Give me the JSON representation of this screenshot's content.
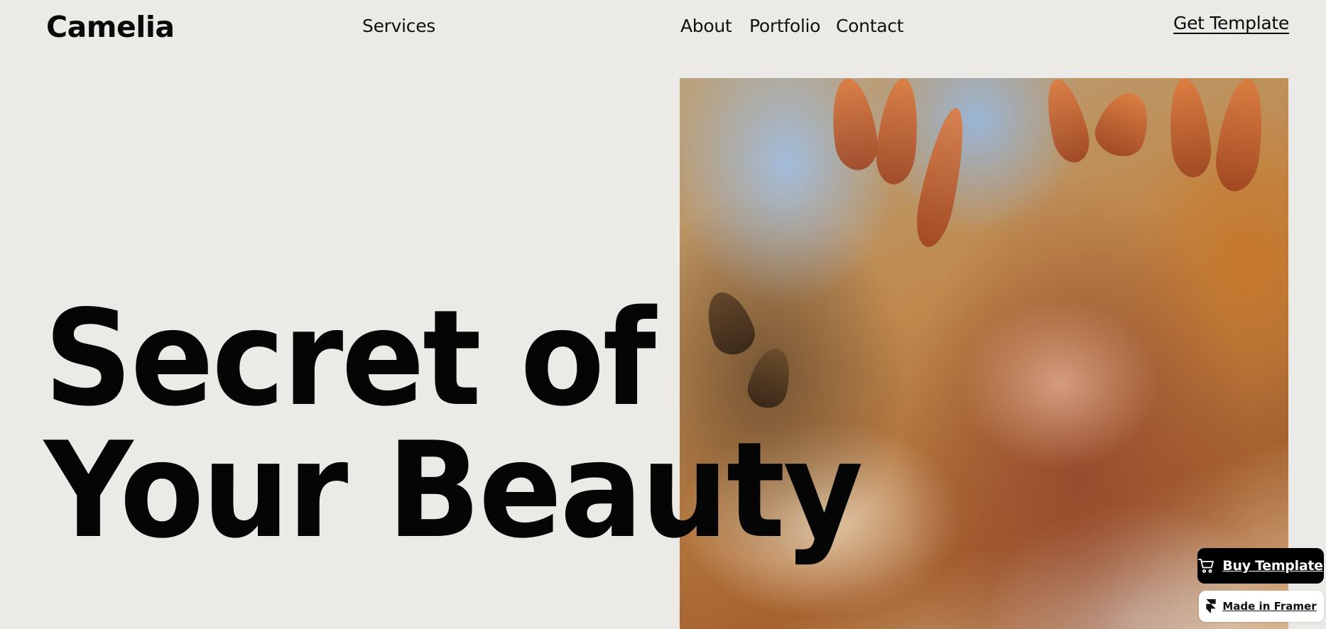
{
  "header": {
    "logo": "Camelia",
    "nav": {
      "services": "Services",
      "about": "About",
      "portfolio": "Portfolio",
      "contact": "Contact"
    },
    "cta": "Get Template"
  },
  "hero": {
    "headline_line1": "Secret of",
    "headline_line2": "Your Beauty",
    "photo_icon": "portrait-photo"
  },
  "floating": {
    "buy_label": "Buy Template",
    "buy_icon": "cart-icon",
    "framer_label": "Made in Framer",
    "framer_icon": "framer-logo-icon"
  },
  "colors": {
    "background": "#ebeae6",
    "text": "#0a0a0a",
    "button_dark": "#000000",
    "button_light": "#ffffff"
  }
}
